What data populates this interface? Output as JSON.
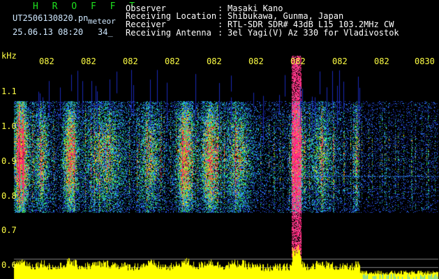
{
  "header": {
    "app_title": "H R O F F T",
    "filename": "UT2506130820.pn",
    "mode": "meteor",
    "datetime": "25.06.13 08:20",
    "count": "34_",
    "fields": [
      {
        "label": "Observer",
        "sep": ":",
        "value": "Masaki Kano"
      },
      {
        "label": "Receiving Location",
        "sep": ":",
        "value": "Shibukawa, Gunma, Japan"
      },
      {
        "label": "Receiver",
        "sep": ":",
        "value": "RTL-SDR SDR# 43dB L15 103.2MHz CW"
      },
      {
        "label": "Receiving Antenna",
        "sep": ":",
        "value": "3el Yagi(V) Az 330 for Vladivostok"
      }
    ]
  },
  "spectrogram": {
    "y_unit": "kHz",
    "y_ticks": [
      "1.1",
      "1.0",
      "0.9",
      "0.8",
      "0.7",
      "0.6"
    ],
    "x_ticks": [
      "082",
      "082",
      "082",
      "082",
      "082",
      "082",
      "082",
      "082",
      "082",
      "0830"
    ],
    "colors": {
      "text": "#ffff44",
      "title": "#1fe01f",
      "level": "#ffff00",
      "background": "#000000"
    }
  }
}
